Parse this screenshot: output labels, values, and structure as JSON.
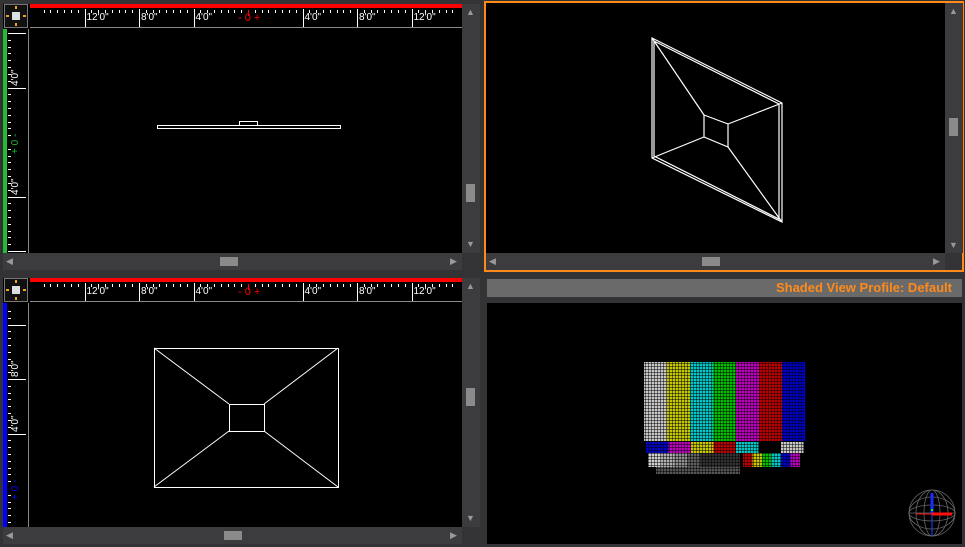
{
  "viewports": {
    "top_left": {
      "h_labels": [
        "12'0\"",
        "8'0\"",
        "4'0\"",
        "- 0 +",
        "4'0\"",
        "8'0\"",
        "12'0\""
      ],
      "v_labels": [
        "4'0\"",
        "+ 0 -",
        "4'0\""
      ],
      "ruler_h_color": "#ff0000",
      "ruler_v_color": "#22bb33"
    },
    "top_right": {
      "active": true,
      "border_color": "#ff8a1a"
    },
    "bottom_left": {
      "h_labels": [
        "12'0\"",
        "8'0\"",
        "4'0\"",
        "- 0 +",
        "4'0\"",
        "8'0\"",
        "12'0\""
      ],
      "v_labels": [
        "8'0\"",
        "4'0\"",
        "+ 0 -"
      ],
      "ruler_h_color": "#ff0000",
      "ruler_v_color": "#0000ff"
    },
    "bottom_right": {
      "header": "Shaded View Profile: Default",
      "header_color": "#ff8a1a"
    }
  },
  "scroll_arrows": {
    "up": "▲",
    "down": "▼",
    "left": "◀",
    "right": "▶"
  }
}
